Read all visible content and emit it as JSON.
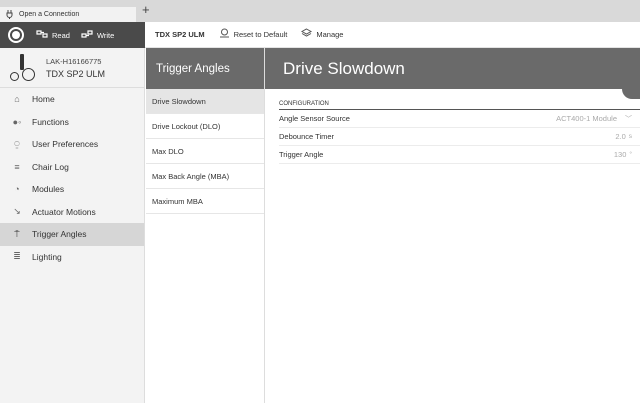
{
  "tab": {
    "label": "Open a Connection",
    "icon": "plug-icon"
  },
  "new_tab_label": "+",
  "toolbar_left": {
    "read_label": "Read",
    "write_label": "Write"
  },
  "toolbar_right": {
    "device_name": "TDX SP2 ULM",
    "reset_label": "Reset to Default",
    "manage_label": "Manage"
  },
  "device": {
    "id": "LAK-H16166775",
    "model": "TDX SP2 ULM"
  },
  "sidebar": {
    "items": [
      {
        "label": "Home",
        "icon": "home-icon"
      },
      {
        "label": "Functions",
        "icon": "functions-icon"
      },
      {
        "label": "User Preferences",
        "icon": "user-icon"
      },
      {
        "label": "Chair Log",
        "icon": "log-icon"
      },
      {
        "label": "Modules",
        "icon": "modules-icon"
      },
      {
        "label": "Actuator Motions",
        "icon": "actuator-icon"
      },
      {
        "label": "Trigger Angles",
        "icon": "trigger-icon"
      },
      {
        "label": "Lighting",
        "icon": "lighting-icon"
      }
    ],
    "active_index": 6
  },
  "subnav": {
    "header": "Trigger Angles",
    "items": [
      {
        "label": "Drive Slowdown"
      },
      {
        "label": "Drive Lockout (DLO)"
      },
      {
        "label": "Max DLO"
      },
      {
        "label": "Max Back Angle (MBA)"
      },
      {
        "label": "Maximum MBA"
      }
    ],
    "active_index": 0
  },
  "content": {
    "title": "Drive Slowdown",
    "section_label": "CONFIGURATION",
    "rows": [
      {
        "label": "Angle Sensor Source",
        "value": "ACT400-1 Module",
        "unit": "",
        "has_dropdown": true
      },
      {
        "label": "Debounce Timer",
        "value": "2.0",
        "unit": "s",
        "has_dropdown": false
      },
      {
        "label": "Trigger Angle",
        "value": "130",
        "unit": "°",
        "has_dropdown": false
      }
    ]
  },
  "colors": {
    "dark_toolbar": "#4a4a4a",
    "header_gray": "#6a6a6a",
    "sidebar_bg": "#f3f3f3",
    "active_item": "#d6d6d6"
  }
}
